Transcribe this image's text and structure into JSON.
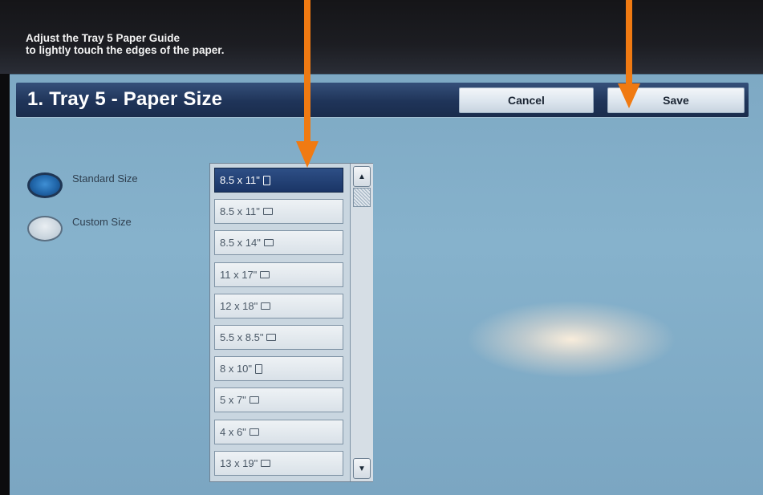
{
  "instruction": "Adjust the Tray 5 Paper Guide\nto lightly touch the edges of the paper.",
  "header": {
    "title": "1. Tray 5 - Paper Size",
    "cancel_label": "Cancel",
    "save_label": "Save"
  },
  "size_type": {
    "options": [
      {
        "label": "Standard Size",
        "selected": true
      },
      {
        "label": "Custom Size",
        "selected": false
      }
    ]
  },
  "paper_sizes": [
    {
      "label": "8.5 x 11\"",
      "orientation": "portrait",
      "selected": true
    },
    {
      "label": "8.5 x 11\"",
      "orientation": "landscape",
      "selected": false
    },
    {
      "label": "8.5 x 14\"",
      "orientation": "landscape",
      "selected": false
    },
    {
      "label": "11 x 17\"",
      "orientation": "landscape",
      "selected": false
    },
    {
      "label": "12 x 18\"",
      "orientation": "landscape",
      "selected": false
    },
    {
      "label": "5.5 x 8.5\"",
      "orientation": "landscape",
      "selected": false
    },
    {
      "label": "8 x 10\"",
      "orientation": "portrait",
      "selected": false
    },
    {
      "label": "5 x 7\"",
      "orientation": "landscape",
      "selected": false
    },
    {
      "label": "4 x 6\"",
      "orientation": "landscape",
      "selected": false
    },
    {
      "label": "13 x 19\"",
      "orientation": "landscape",
      "selected": false
    }
  ],
  "scroll_icons": {
    "up": "triangle-up-icon",
    "down": "triangle-down-icon"
  },
  "colors": {
    "title_bar": "#1f3459",
    "selected_item": "#1a3566",
    "annotation_arrow": "#f07a12",
    "screen_background": "#7ea9c4"
  }
}
